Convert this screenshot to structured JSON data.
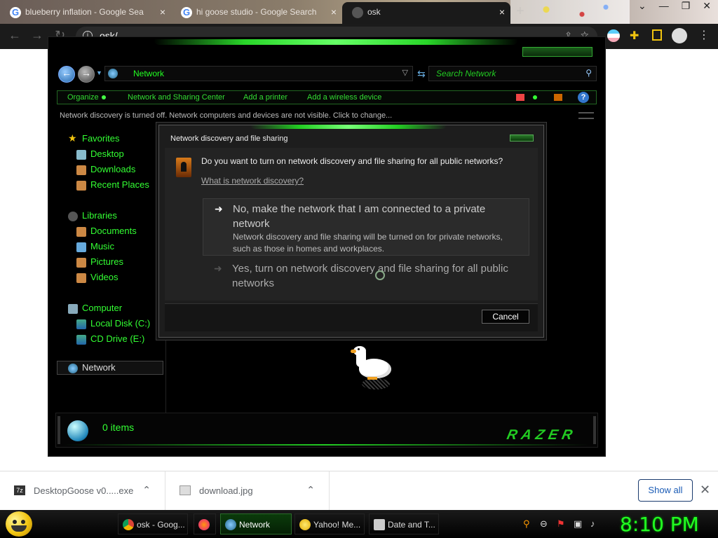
{
  "browser": {
    "tabs": [
      {
        "label": "blueberry inflation - Google Sea",
        "close": "×"
      },
      {
        "label": "hi goose studio - Google Search",
        "close": "×"
      },
      {
        "label": "osk",
        "close": "×"
      }
    ],
    "new_tab": "+",
    "window_controls": {
      "minimize": "⌄",
      "restore": "❐",
      "close": "✕"
    },
    "address": "osk/",
    "nav": {
      "back": "←",
      "forward": "→",
      "reload": "↻"
    }
  },
  "explorer": {
    "location": "Network",
    "search_placeholder": "Search Network",
    "commands": [
      "Organize",
      "Network and Sharing Center",
      "Add a printer",
      "Add a wireless device"
    ],
    "help": "?",
    "infobar": "Network discovery is turned off. Network computers and devices are not visible. Click to change...",
    "nav": {
      "favorites": {
        "label": "Favorites",
        "items": [
          "Desktop",
          "Downloads",
          "Recent Places"
        ]
      },
      "libraries": {
        "label": "Libraries",
        "items": [
          "Documents",
          "Music",
          "Pictures",
          "Videos"
        ]
      },
      "computer": {
        "label": "Computer",
        "items": [
          "Local Disk (C:)",
          "CD Drive (E:)"
        ]
      },
      "network": {
        "label": "Network"
      }
    },
    "status": {
      "items": "0 items",
      "brand": "RAZER"
    }
  },
  "dialog": {
    "title": "Network discovery and file sharing",
    "question": "Do you want to turn on network discovery and file sharing for all public networks?",
    "link": "What is network discovery?",
    "option1": {
      "heading": "No, make the network that I am connected to a private network",
      "desc": "Network discovery and file sharing will be turned on for private networks, such as those in homes and workplaces."
    },
    "option2": {
      "heading": "Yes, turn on network discovery and file sharing for all public networks"
    },
    "cancel": "Cancel"
  },
  "downloads": {
    "items": [
      {
        "name": "DesktopGoose v0.....exe"
      },
      {
        "name": "download.jpg"
      }
    ],
    "show_all": "Show all",
    "close": "✕"
  },
  "taskbar": {
    "tasks": [
      "osk - Goog...",
      "",
      "Network",
      "Yahoo! Me...",
      "Date and T..."
    ],
    "clock": "8:10 PM"
  },
  "colors": {
    "accent_green": "#22dd22",
    "dark_bg": "#000000"
  }
}
